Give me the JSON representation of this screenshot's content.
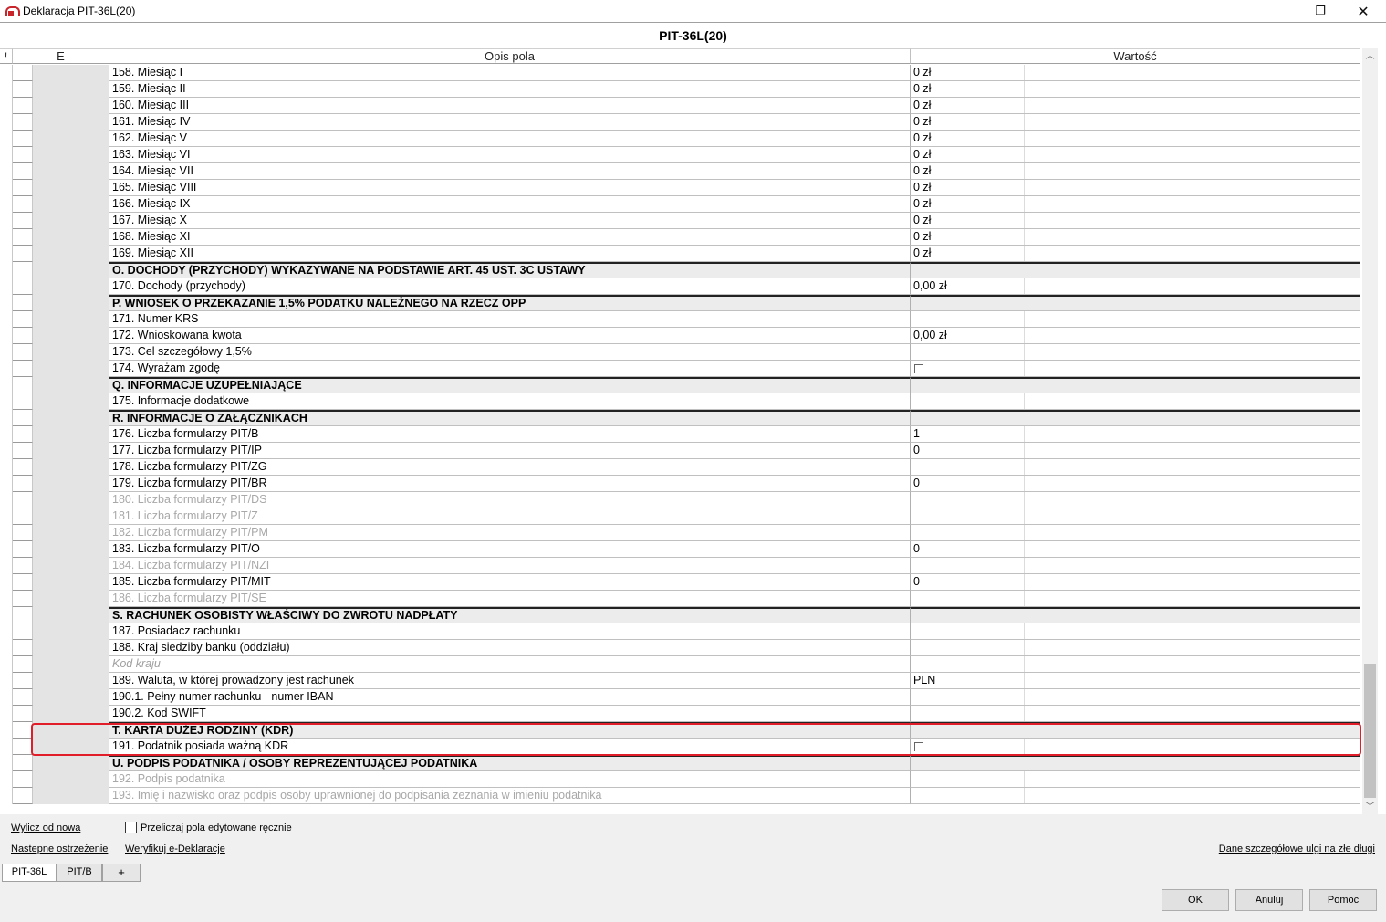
{
  "window": {
    "title": "Deklaracja PIT-36L(20)",
    "restore_glyph": "❐",
    "close_glyph": "✕"
  },
  "grid": {
    "title": "PIT-36L(20)",
    "marker_header": "!",
    "columns": {
      "e": "E",
      "opis": "Opis pola",
      "wartosc": "Wartość"
    },
    "rows": [
      {
        "label": "158. Miesiąc I",
        "value": "0 zł",
        "kind": "field"
      },
      {
        "label": "159. Miesiąc II",
        "value": "0 zł",
        "kind": "field"
      },
      {
        "label": "160. Miesiąc III",
        "value": "0 zł",
        "kind": "field"
      },
      {
        "label": "161. Miesiąc IV",
        "value": "0 zł",
        "kind": "field"
      },
      {
        "label": "162. Miesiąc V",
        "value": "0 zł",
        "kind": "field"
      },
      {
        "label": "163. Miesiąc VI",
        "value": "0 zł",
        "kind": "field"
      },
      {
        "label": "164. Miesiąc VII",
        "value": "0 zł",
        "kind": "field"
      },
      {
        "label": "165. Miesiąc VIII",
        "value": "0 zł",
        "kind": "field"
      },
      {
        "label": "166. Miesiąc IX",
        "value": "0 zł",
        "kind": "field"
      },
      {
        "label": "167. Miesiąc X",
        "value": "0 zł",
        "kind": "field"
      },
      {
        "label": "168. Miesiąc XI",
        "value": "0 zł",
        "kind": "field"
      },
      {
        "label": "169. Miesiąc XII",
        "value": "0 zł",
        "kind": "field"
      },
      {
        "label": "O. DOCHODY (PRZYCHODY) WYKAZYWANE NA PODSTAWIE ART. 45 UST. 3C USTAWY",
        "value": "",
        "kind": "section"
      },
      {
        "label": "170. Dochody (przychody)",
        "value": "0,00 zł",
        "kind": "field"
      },
      {
        "label": "P. WNIOSEK O PRZEKAZANIE 1,5% PODATKU NALEŻNEGO NA RZECZ OPP",
        "value": "",
        "kind": "section"
      },
      {
        "label": "171. Numer KRS",
        "value": "",
        "kind": "field"
      },
      {
        "label": "172. Wnioskowana kwota",
        "value": "0,00 zł",
        "kind": "field"
      },
      {
        "label": "173. Cel szczegółowy 1,5%",
        "value": "",
        "kind": "field"
      },
      {
        "label": "174. Wyrażam zgodę",
        "value": "",
        "kind": "checkbox"
      },
      {
        "label": "Q. INFORMACJE UZUPEŁNIAJĄCE",
        "value": "",
        "kind": "section"
      },
      {
        "label": "175. Informacje dodatkowe",
        "value": "",
        "kind": "field"
      },
      {
        "label": "R. INFORMACJE O ZAŁĄCZNIKACH",
        "value": "",
        "kind": "section"
      },
      {
        "label": "176. Liczba formularzy PIT/B",
        "value": "1",
        "kind": "field"
      },
      {
        "label": "177. Liczba formularzy PIT/IP",
        "value": "0",
        "kind": "field"
      },
      {
        "label": "178. Liczba formularzy PIT/ZG",
        "value": "",
        "kind": "field"
      },
      {
        "label": "179. Liczba formularzy PIT/BR",
        "value": "0",
        "kind": "field"
      },
      {
        "label": "180. Liczba formularzy PIT/DS",
        "value": "",
        "kind": "disabled"
      },
      {
        "label": "181. Liczba formularzy PIT/Z",
        "value": "",
        "kind": "disabled"
      },
      {
        "label": "182. Liczba formularzy PIT/PM",
        "value": "",
        "kind": "disabled"
      },
      {
        "label": "183. Liczba formularzy PIT/O",
        "value": "0",
        "kind": "field"
      },
      {
        "label": "184. Liczba formularzy PIT/NZI",
        "value": "",
        "kind": "disabled"
      },
      {
        "label": "185. Liczba formularzy PIT/MIT",
        "value": "0",
        "kind": "field"
      },
      {
        "label": "186. Liczba formularzy PIT/SE",
        "value": "",
        "kind": "disabled"
      },
      {
        "label": "S. RACHUNEK OSOBISTY WŁAŚCIWY DO ZWROTU NADPŁATY",
        "value": "",
        "kind": "section"
      },
      {
        "label": "187. Posiadacz rachunku",
        "value": "",
        "kind": "field"
      },
      {
        "label": "188. Kraj siedziby banku (oddziału)",
        "value": "",
        "kind": "field"
      },
      {
        "label": "Kod kraju",
        "value": "",
        "kind": "hint"
      },
      {
        "label": "189. Waluta, w której prowadzony jest rachunek",
        "value": "PLN",
        "kind": "field"
      },
      {
        "label": "190.1. Pełny numer rachunku - numer IBAN",
        "value": "",
        "kind": "field"
      },
      {
        "label": "190.2. Kod SWIFT",
        "value": "",
        "kind": "field"
      },
      {
        "label": "T. KARTA DUŻEJ RODZINY (KDR)",
        "value": "",
        "kind": "section"
      },
      {
        "label": "191. Podatnik posiada ważną KDR",
        "value": "",
        "kind": "checkbox"
      },
      {
        "label": "U. PODPIS PODATNIKA / OSOBY REPREZENTUJĄCEJ PODATNIKA",
        "value": "",
        "kind": "section"
      },
      {
        "label": "192. Podpis podatnika",
        "value": "",
        "kind": "disabled"
      },
      {
        "label": "193. Imię i nazwisko oraz podpis osoby uprawnionej do podpisania zeznania w imieniu podatnika",
        "value": "",
        "kind": "disabled"
      }
    ]
  },
  "scrollbar": {
    "up_glyph": "︿",
    "down_glyph": "﹀"
  },
  "bottom": {
    "recalc_link": "Wylicz od nowa",
    "recalc_manual_label": "Przeliczaj pola edytowane ręcznie",
    "recalc_manual_checked": false,
    "next_warning_link": "Nastepne ostrzeżenie",
    "verify_link": "Weryfikuj e-Deklaracje",
    "bad_debt_link": "Dane szczegółowe ulgi na złe długi"
  },
  "tabs": [
    {
      "label": "PIT-36L",
      "active": true
    },
    {
      "label": "PIT/B",
      "active": false
    },
    {
      "label": "+",
      "active": false
    }
  ],
  "buttons": {
    "ok": "OK",
    "cancel": "Anuluj",
    "help": "Pomoc"
  },
  "colors": {
    "highlight": "#e11d2a",
    "section_bg": "#ececec",
    "disabled_text": "#a8a8a8"
  }
}
